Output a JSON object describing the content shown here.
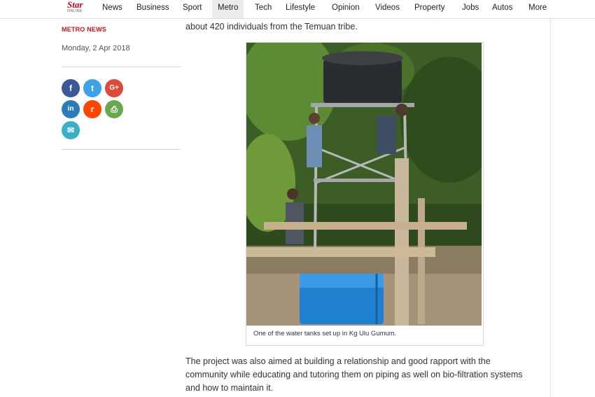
{
  "nav": {
    "logo_text": "Star",
    "logo_sub": "ONLINE",
    "items": [
      "News",
      "Business",
      "Sport",
      "Metro",
      "Tech",
      "Lifestyle",
      "Opinion",
      "Videos",
      "Property",
      "Jobs",
      "Autos",
      "More"
    ],
    "active": "Metro"
  },
  "sidebar": {
    "section_label": "METRO NEWS",
    "date": "Monday, 2 Apr 2018",
    "share_icons": [
      {
        "name": "facebook-icon",
        "glyph": "f",
        "color": "#3b5998"
      },
      {
        "name": "twitter-icon",
        "glyph": "t",
        "color": "#3da3e6"
      },
      {
        "name": "google-plus-icon",
        "glyph": "G+",
        "color": "#dd4b39"
      },
      {
        "name": "linkedin-icon",
        "glyph": "in",
        "color": "#2b7bb9"
      },
      {
        "name": "reddit-icon",
        "glyph": "r",
        "color": "#ff4500"
      },
      {
        "name": "print-icon",
        "glyph": "⎙",
        "color": "#6aa84f"
      },
      {
        "name": "email-icon",
        "glyph": "✉",
        "color": "#3ab0c8"
      }
    ]
  },
  "article": {
    "intro_line": "about 420 individuals from the Temuan tribe.",
    "caption": "One of the water tanks set up in Kg Ulu Gumum.",
    "paragraph_lines": [
      "The project was also aimed at building a relationship and good rapport with the",
      "community while educating and tutoring them on piping as well on bio-filtration systems",
      "and how to maintain it."
    ]
  }
}
